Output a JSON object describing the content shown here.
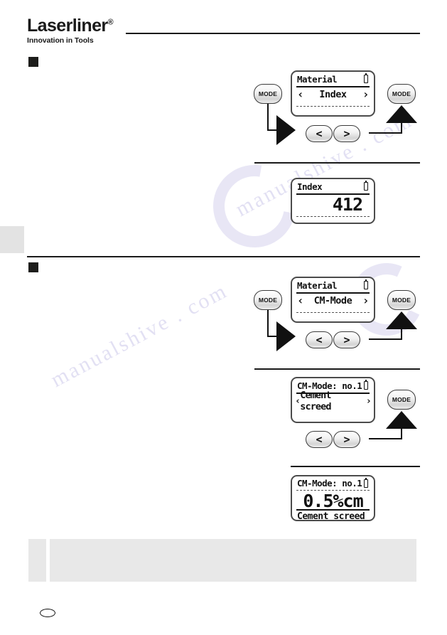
{
  "brand": {
    "name": "Laserliner",
    "registered": "®",
    "tagline": "Innovation in Tools"
  },
  "sections": [
    {
      "id": "index-section",
      "bullet": "black-square-bullet",
      "steps": [
        {
          "mode_button": "MODE",
          "nav_left": "<",
          "nav_right": ">",
          "display": {
            "title": "Material",
            "battery_icon": "battery-icon",
            "chevron_left": "‹",
            "label": "Index",
            "chevron_right": "›"
          }
        },
        {
          "mode_button": "MODE",
          "display": {
            "title": "Index",
            "battery_icon": "battery-icon",
            "value": "412"
          }
        }
      ]
    },
    {
      "id": "cm-mode-section",
      "bullet": "black-square-bullet",
      "steps": [
        {
          "mode_button": "MODE",
          "nav_left": "<",
          "nav_right": ">",
          "display": {
            "title": "Material",
            "battery_icon": "battery-icon",
            "chevron_left": "‹",
            "label": "CM-Mode",
            "chevron_right": "›"
          }
        },
        {
          "mode_button": "MODE",
          "nav_left": "<",
          "nav_right": ">",
          "display": {
            "title": "CM-Mode: no.1",
            "battery_icon": "battery-icon",
            "bracket_left": "‹",
            "label": "Cement screed",
            "bracket_right": "›"
          }
        },
        {
          "display": {
            "title": "CM-Mode: no.1",
            "battery_icon": "battery-icon",
            "value": "0.5%cm",
            "footer": "Cement screed"
          }
        }
      ]
    }
  ],
  "note_box": {
    "icon": "note-icon",
    "text": ""
  },
  "footer": {
    "page_marker": "page-number-oval"
  },
  "watermark": {
    "line1": "manualshive . com",
    "line2": "manualshive . com"
  },
  "colors": {
    "ink": "#1a1a1a",
    "lcd_border": "#4b4b4b",
    "note_bg": "#e8e8e8",
    "tab_gray": "#e3e3e3"
  }
}
